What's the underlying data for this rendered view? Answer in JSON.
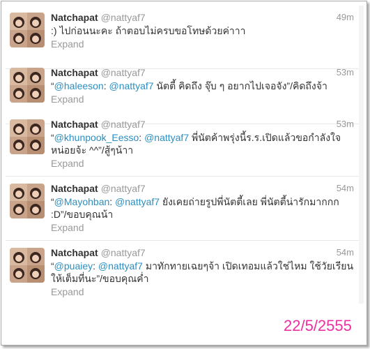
{
  "tweets": [
    {
      "name": "Natchapat",
      "handle": "@nattyaf7",
      "time": "49m",
      "text_before": ":) ไปก่อนนะคะ ถ้าตอบไม่ครบขอโทษด้วยค่าาา",
      "mention1": "",
      "mention2": "",
      "text_after": "",
      "expand": "Expand"
    },
    {
      "name": "Natchapat",
      "handle": "@nattyaf7",
      "time": "53m",
      "text_before": "“",
      "mention1": "@haleeson",
      "mention2": "@nattyaf7",
      "text_after": " นัตตี้ คิดถึง จุ๊บ ๆ อยากไปเจอจัง”/คิดถึงจ้า",
      "expand": "Expand"
    },
    {
      "name": "Natchapat",
      "handle": "@nattyaf7",
      "time": "53m",
      "text_before": "“",
      "mention1": "@khunpook_Eesso",
      "mention2": "@nattyaf7",
      "text_after": " พี่นัตค้าพรุ่งนี้ร.ร.เปิดแล้วขอกำลังใจหน่อยจ้ะ ^^”/สู้ๆน้าา",
      "expand": "Expand"
    },
    {
      "name": "Natchapat",
      "handle": "@nattyaf7",
      "time": "54m",
      "text_before": "“",
      "mention1": "@Mayohban",
      "mention2": "@nattyaf7",
      "text_after": " ยังเคยถ่ายรูปพี่นัตตี้เลย พี่นัตตี้น่ารักมากกก :D”/ขอบคุณน้า",
      "expand": "Expand"
    },
    {
      "name": "Natchapat",
      "handle": "@nattyaf7",
      "time": "54m",
      "text_before": "“",
      "mention1": "@puaiey",
      "mention2": "@nattyaf7",
      "text_after": " มาทักทายเฉยๆจ้า เปิดเทอมแล้วใช่ไหม ใช้วัยเรียนให้เต็มที่นะ”/ขอบคุณค่ำ",
      "expand": "Expand"
    }
  ],
  "date_stamp": "22/5/2555",
  "colors": {
    "link": "#2b8fc0",
    "name": "#333333",
    "muted": "#999999",
    "date_stamp": "#ee2fa0"
  }
}
